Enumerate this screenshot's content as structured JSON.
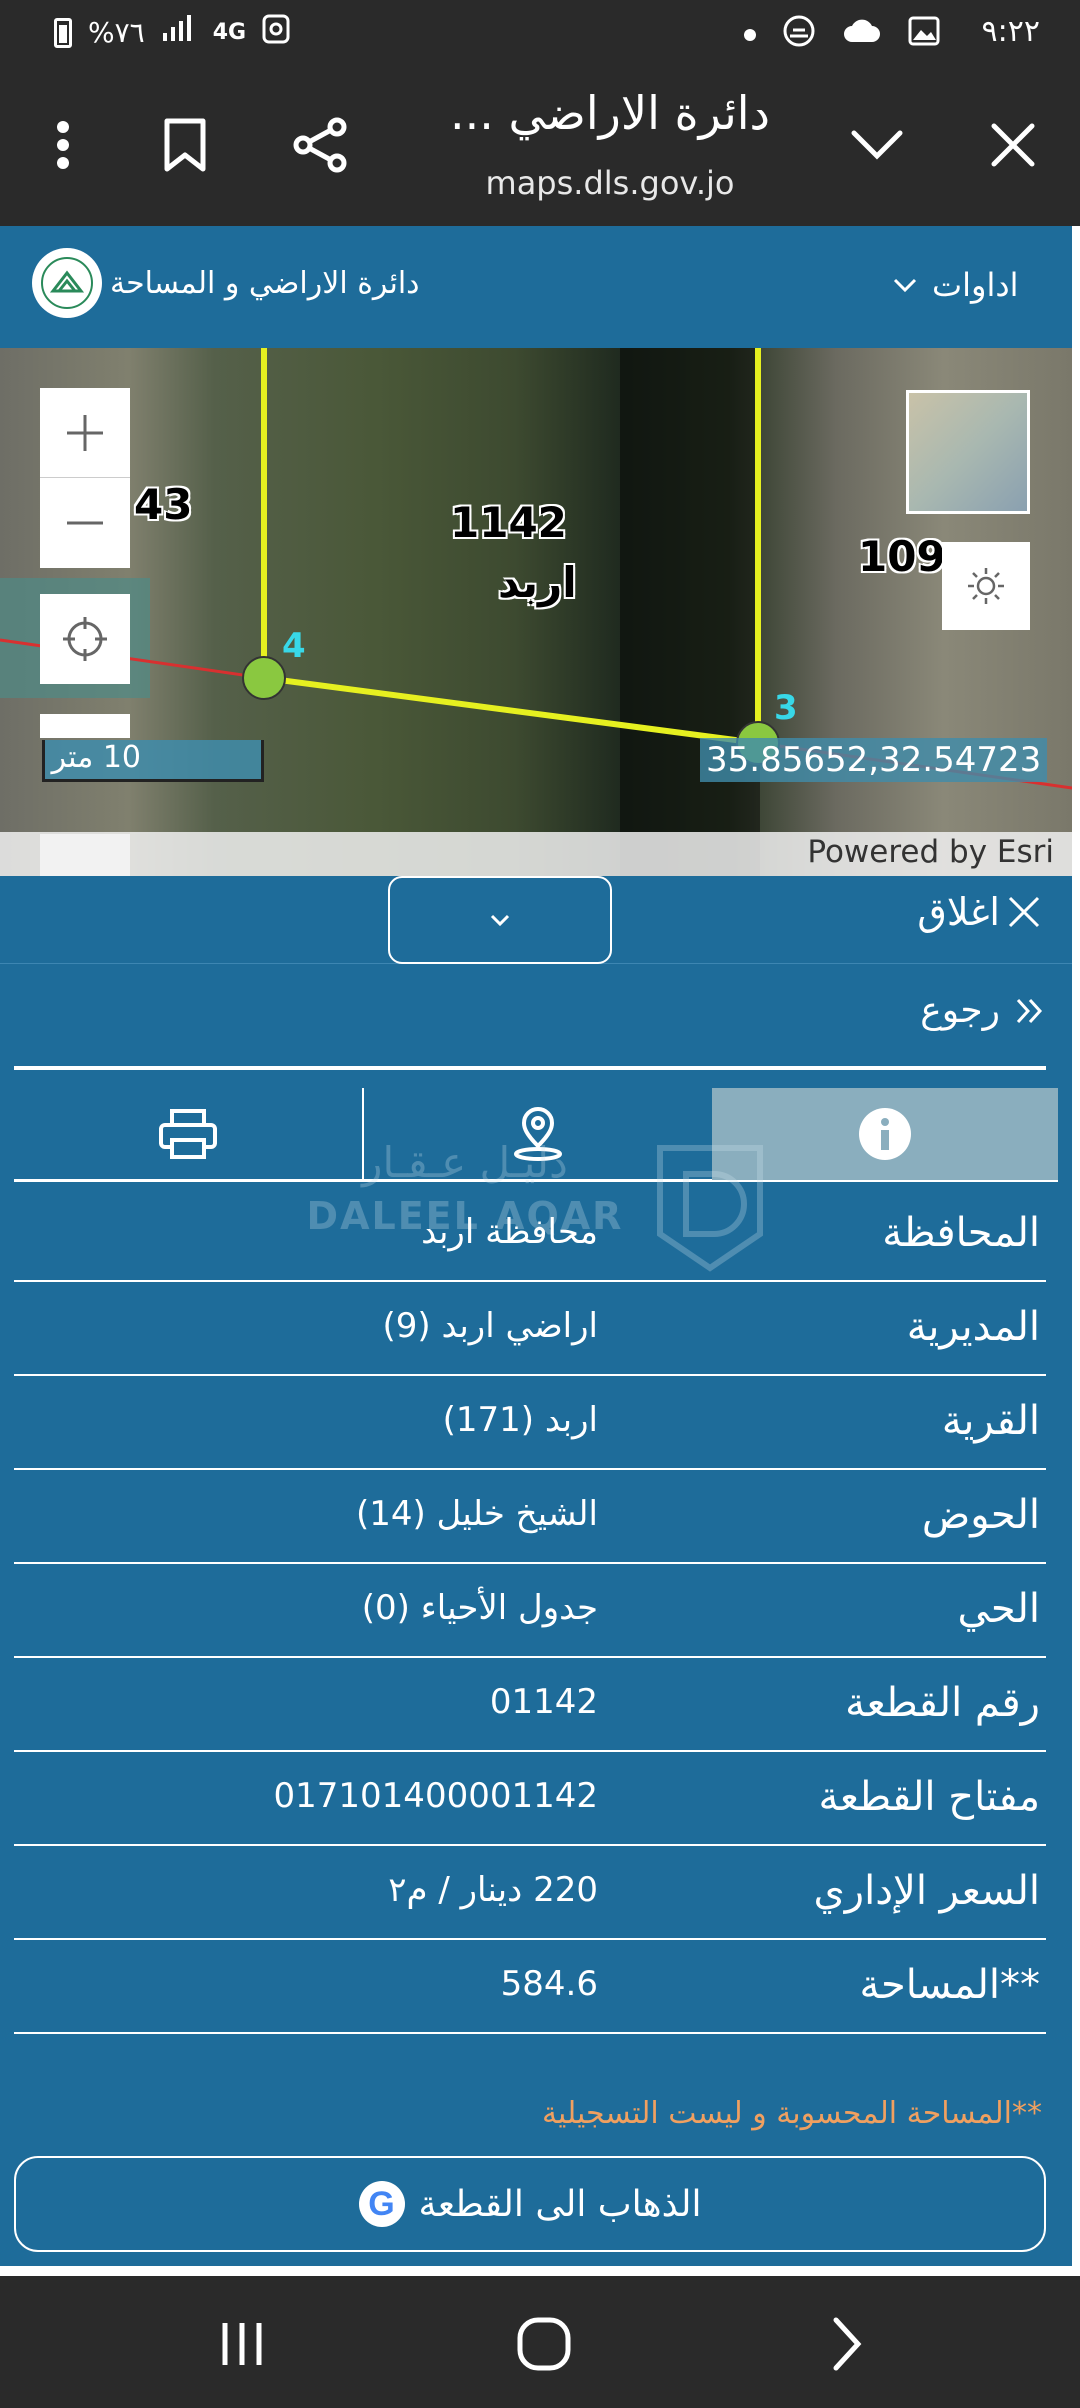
{
  "status_bar": {
    "time": "٩:٢٢",
    "battery": "%٧٦",
    "network": "4G"
  },
  "browser": {
    "title": "دائرة الاراضي ...",
    "url": "maps.dls.gov.jo"
  },
  "site_header": {
    "site_name": "دائرة الاراضي و المساحة",
    "tools_label": "اداوات"
  },
  "map": {
    "parcel_main_number": "1142",
    "parcel_main_city": "اربد",
    "parcel_left_number": "43",
    "parcel_right_number": "109",
    "vertex_a": "4",
    "vertex_b": "3",
    "coordinates": "35.85652,32.54723",
    "scale_label": "10 متر",
    "attribution": "Powered by Esri"
  },
  "panel": {
    "close_label": "اغلاق",
    "back_label": "رجوع",
    "watermark_ar": "دليـل عـقـار",
    "watermark_en": "DALEEL AQAR",
    "rows": [
      {
        "label": "المحافظة",
        "value": "محافظة اربد"
      },
      {
        "label": "المديرية",
        "value": "اراضي اربد (9)"
      },
      {
        "label": "القرية",
        "value": "اربد (171)"
      },
      {
        "label": "الحوض",
        "value": "الشيخ خليل (14)"
      },
      {
        "label": "الحي",
        "value": "جدول الأحياء (0)"
      },
      {
        "label": "رقم القطعة",
        "value": "01142"
      },
      {
        "label": "مفتاح القطعة",
        "value": "017101400001142"
      },
      {
        "label": "السعر الإداري",
        "value": "220 دينار / م٢"
      },
      {
        "label": "**المساحة",
        "value": "584.6"
      }
    ],
    "note": "**المساحة المحسوبة و ليست التسجيلية",
    "goto_label": "الذهاب الى القطعة",
    "google_letter": "G"
  },
  "colors": {
    "panel_blue": "#1e6c9a",
    "parcel_line": "#e6f020",
    "note_orange": "#f0a060"
  }
}
